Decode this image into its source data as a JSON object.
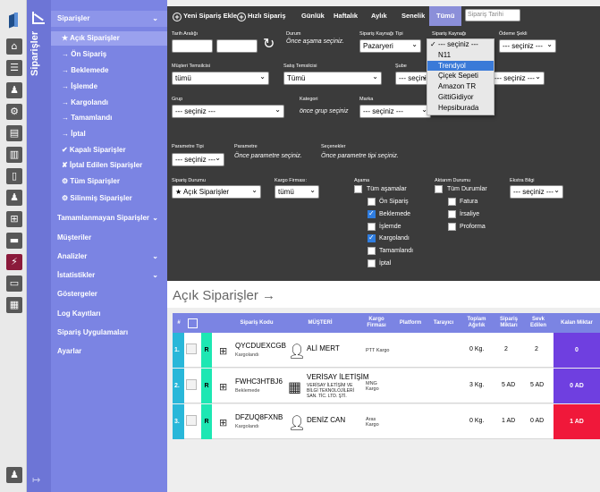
{
  "section_title": "Siparişler",
  "menu": {
    "top_label": "Siparişler",
    "sub_items": [
      {
        "label": "★ Açık Siparişler"
      },
      {
        "label": "→ Ön Sipariş"
      },
      {
        "label": "→ Beklemede"
      },
      {
        "label": "→ İşlemde"
      },
      {
        "label": "→ Kargolandı"
      },
      {
        "label": "→ Tamamlandı"
      },
      {
        "label": "→ İptal"
      },
      {
        "label": "✔ Kapalı Siparişler"
      },
      {
        "label": "✘ İptal Edilen Siparişler"
      },
      {
        "label": "⚙ Tüm Siparişler"
      },
      {
        "label": "⚙ Silinmiş Siparişler"
      }
    ],
    "groups": [
      {
        "label": "Tamamlanmayan Siparişler"
      },
      {
        "label": "Müşteriler"
      },
      {
        "label": "Analizler"
      },
      {
        "label": "İstatistikler"
      },
      {
        "label": "Göstergeler"
      },
      {
        "label": "Log Kayıtları"
      },
      {
        "label": "Sipariş Uygulamaları"
      },
      {
        "label": "Ayarlar"
      }
    ]
  },
  "topbar": {
    "new_order": "Yeni Sipariş Ekle",
    "quick_order": "Hızlı Sipariş",
    "tabs": [
      "Günlük",
      "Haftalık",
      "Aylık",
      "Senelik",
      "Tümü"
    ],
    "date_placeholder": "Sipariş Tarihi"
  },
  "filters": {
    "date_range_label": "Tarih Aralığı",
    "status_label": "Durum",
    "status_hint": "Önce aşama seçiniz.",
    "source_type_label": "Sipariş Kaynağı Tipi",
    "source_type_value": "Pazaryeri",
    "source_label": "Sipariş Kaynağı",
    "payment_label": "Ödeme Şekli",
    "payment_value": "--- seçiniz ---",
    "rep_label": "Müşteri Temsilcisi",
    "rep_value": "tümü",
    "sales_label": "Satış Temsilcisi",
    "sales_value": "Tümü",
    "branch_label": "Şube",
    "branch_value": "--- seçiniz ---",
    "extra_value": "--- seçiniz ---",
    "group_label": "Grup",
    "group_value": "--- seçiniz ---",
    "category_label": "Kategori",
    "category_hint": "önce grup seçiniz",
    "brand_label": "Marka",
    "brand_value": "--- seçiniz ---",
    "param_type_label": "Parametre Tipi",
    "param_type_value": "--- seçiniz ---",
    "param_label": "Parametre",
    "param_hint": "Önce parametre seçiniz.",
    "options_label": "Seçenekler",
    "options_hint": "Önce parametre tipi seçiniz.",
    "order_status_label": "Sipariş Durumu",
    "order_status_value": "★ Açık Siparişler",
    "cargo_firm_label": "Kargo Firması:",
    "cargo_firm_value": "tümü",
    "stage_label": "Aşama",
    "stages": [
      {
        "label": "Tüm aşamalar",
        "checked": false
      },
      {
        "label": "Ön Sipariş",
        "checked": false
      },
      {
        "label": "Beklemede",
        "checked": true
      },
      {
        "label": "İşlemde",
        "checked": false
      },
      {
        "label": "Kargolandı",
        "checked": true
      },
      {
        "label": "Tamamlandı",
        "checked": false
      },
      {
        "label": "İptal",
        "checked": false
      }
    ],
    "transfer_label": "Aktarım Durumu",
    "transfers": [
      {
        "label": "Tüm Durumlar",
        "checked": false
      },
      {
        "label": "Fatura",
        "checked": false
      },
      {
        "label": "İrsaliye",
        "checked": false
      },
      {
        "label": "Proforma",
        "checked": false
      }
    ],
    "extra_info_label": "Ekstra Bilgi",
    "extra_info_value": "--- seçiniz ---"
  },
  "source_dropdown": {
    "options": [
      "--- seçiniz ---",
      "N11",
      "Trendyol",
      "Çiçek Sepeti",
      "Amazon TR",
      "GittiGidiyor",
      "Hepsiburada"
    ],
    "selected_index": 0,
    "highlighted_index": 2
  },
  "content": {
    "title": "Açık Siparişler →",
    "columns": [
      "#",
      "Sipariş Kodu",
      "MÜŞTERİ",
      "Kargo Firması",
      "Platform",
      "Tarayıcı",
      "Toplam Ağırlık",
      "Sipariş Miktarı",
      "Sevk Edilen",
      "Kalan Miktar"
    ],
    "rows": [
      {
        "num": "1.",
        "r": "R",
        "code": "QYCDUEXCGB",
        "status": "Kargolandı",
        "customer": "ALİ MERT",
        "customer_sub": "",
        "cargo": "PTT Kargo",
        "weight": "0 Kg.",
        "ordered": "2",
        "shipped": "2",
        "remaining": "0",
        "remaining_color": "#6f3fe0"
      },
      {
        "num": "2.",
        "r": "R",
        "code": "FWHC3HTBJ6",
        "status": "Beklemede",
        "customer": "VERİSAY İLETİŞİM",
        "customer_sub": "VERİSAY İLETİŞİM VE BİLGİ TEKNOLOJİLERİ SAN. TİC. LTD. ŞTİ.",
        "cargo": "MNG Kargo",
        "weight": "3 Kg.",
        "ordered": "5 AD",
        "shipped": "5 AD",
        "remaining": "0 AD",
        "remaining_color": "#6f3fe0"
      },
      {
        "num": "3.",
        "r": "R",
        "code": "DFZUQ8FXNB",
        "status": "Kargolandı",
        "customer": "DENİZ CAN",
        "customer_sub": "",
        "cargo": "Aras Kargo",
        "weight": "0 Kg.",
        "ordered": "1 AD",
        "shipped": "0 AD",
        "remaining": "1 AD",
        "remaining_color": "#f0183a"
      }
    ]
  }
}
